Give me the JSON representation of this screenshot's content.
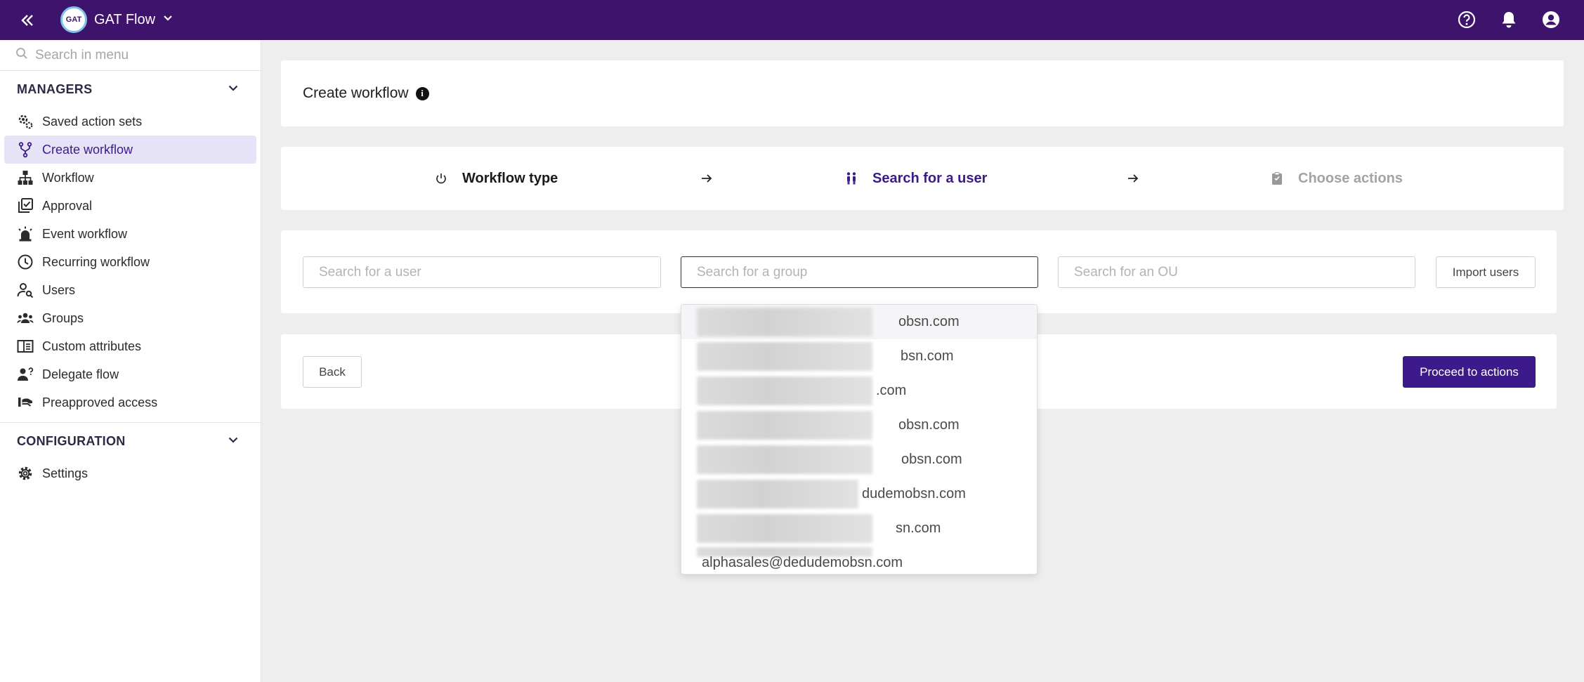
{
  "app": {
    "name": "GAT Flow"
  },
  "menu_search": {
    "placeholder": "Search in menu"
  },
  "sidebar": {
    "managers_header": "MANAGERS",
    "items": [
      {
        "label": "Saved action sets",
        "icon": "gears-icon"
      },
      {
        "label": "Create workflow",
        "icon": "fork-icon",
        "active": true
      },
      {
        "label": "Workflow",
        "icon": "hierarchy-icon"
      },
      {
        "label": "Approval",
        "icon": "approval-icon"
      },
      {
        "label": "Event workflow",
        "icon": "siren-icon"
      },
      {
        "label": "Recurring workflow",
        "icon": "clock-icon"
      },
      {
        "label": "Users",
        "icon": "user-search-icon"
      },
      {
        "label": "Groups",
        "icon": "groups-icon"
      },
      {
        "label": "Custom attributes",
        "icon": "attributes-icon"
      },
      {
        "label": "Delegate flow",
        "icon": "delegate-icon"
      },
      {
        "label": "Preapproved access",
        "icon": "preapproved-icon"
      }
    ],
    "configuration_header": "CONFIGURATION",
    "config_items": [
      {
        "label": "Settings",
        "icon": "gear-icon"
      }
    ]
  },
  "page": {
    "title": "Create workflow"
  },
  "steps": [
    {
      "label": "Workflow type",
      "state": "done"
    },
    {
      "label": "Search for a user",
      "state": "active"
    },
    {
      "label": "Choose actions",
      "state": "pending"
    }
  ],
  "search": {
    "user_placeholder": "Search for a user",
    "group_placeholder": "Search for a group",
    "ou_placeholder": "Search for an OU",
    "import_label": "Import users"
  },
  "actions": {
    "back_label": "Back",
    "proceed_label": "Proceed to actions"
  },
  "dropdown": {
    "options": [
      "obsn.com",
      "bsn.com",
      ".com",
      "obsn.com",
      "obsn.com",
      "dudemobsn.com",
      "sn.com",
      "alphasales@dedudemobsn.com"
    ]
  },
  "colors": {
    "topbar": "#3e136c",
    "accent": "#3d1a8c",
    "active_bg": "#e6e3f7",
    "pending_step": "#a3a3a3"
  }
}
